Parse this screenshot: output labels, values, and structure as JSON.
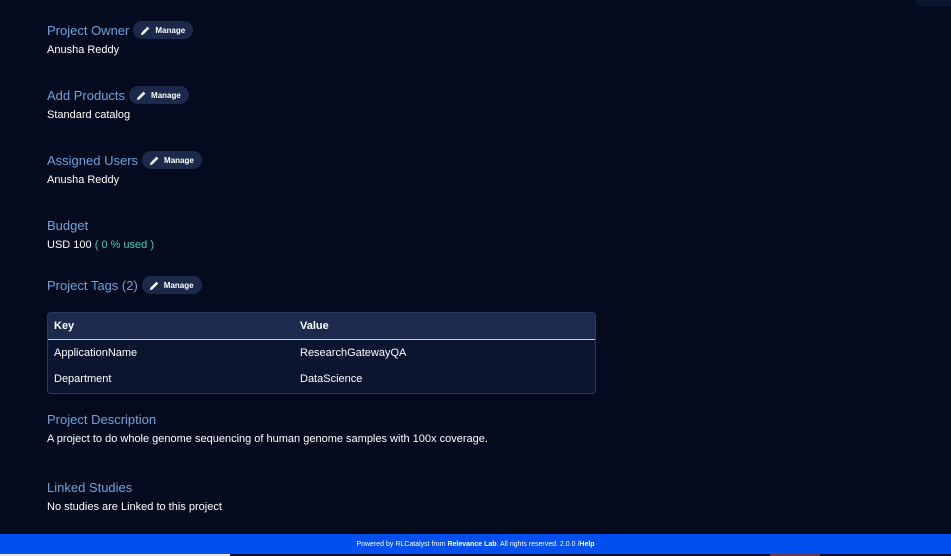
{
  "manage_label": "Manage",
  "sections": {
    "owner": {
      "title": "Project Owner",
      "value": "Anusha Reddy"
    },
    "products": {
      "title": "Add Products",
      "value": "Standard catalog"
    },
    "users": {
      "title": "Assigned Users",
      "value": "Anusha Reddy"
    },
    "budget": {
      "title": "Budget",
      "amount": "USD 100",
      "used": "( 0 % used )"
    },
    "tags": {
      "title": "Project Tags (2)"
    },
    "description": {
      "title": "Project Description",
      "value": "A project to do whole genome sequencing of human genome samples with 100x coverage."
    },
    "studies": {
      "title": "Linked Studies",
      "value": "No studies are Linked to this project"
    }
  },
  "tags_table": {
    "headers": {
      "key": "Key",
      "value": "Value"
    },
    "rows": [
      {
        "key": "ApplicationName",
        "value": "ResearchGatewayQA"
      },
      {
        "key": "Department",
        "value": "DataScience"
      }
    ]
  },
  "footer": {
    "prefix": "Powered by RLCatalyst from ",
    "company": "Relevance Lab",
    "rights": ". All rights reserved. 2.0.0 / ",
    "help": "Help"
  },
  "colors": {
    "background": "#050b1e",
    "title": "#6fa3dc",
    "used": "#3dcfb6",
    "footer": "#0050f0"
  }
}
